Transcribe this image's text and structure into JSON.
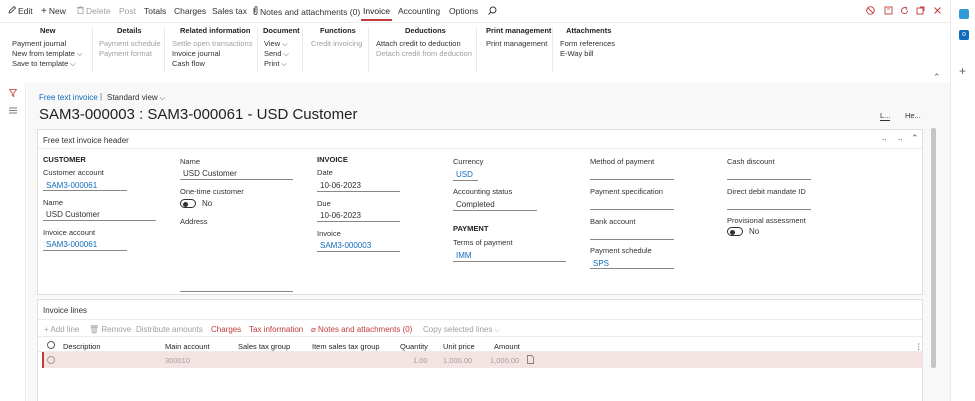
{
  "actionbar": {
    "edit": "Edit",
    "new": "New",
    "delete": "Delete",
    "post": "Post",
    "totals": "Totals",
    "charges": "Charges",
    "sales_tax": "Sales tax",
    "notes": "Notes and attachments (0)",
    "invoice": "Invoice",
    "accounting": "Accounting",
    "options": "Options"
  },
  "ribbon": {
    "new": {
      "title": "New",
      "items": [
        "Payment journal",
        "New from template",
        "Save to template"
      ]
    },
    "details": {
      "title": "Details",
      "items": [
        "Payment schedule",
        "Payment format"
      ]
    },
    "related": {
      "title": "Related information",
      "items": [
        "Settle open transactions",
        "Invoice journal",
        "Cash flow"
      ]
    },
    "document": {
      "title": "Document",
      "items": [
        "View",
        "Send",
        "Print"
      ]
    },
    "functions": {
      "title": "Functions",
      "items": [
        "Credit invoicing"
      ]
    },
    "deductions": {
      "title": "Deductions",
      "items": [
        "Attach credit to deduction",
        "Detach credit from deduction"
      ]
    },
    "print": {
      "title": "Print management",
      "items": [
        "Print management"
      ]
    },
    "attachments": {
      "title": "Attachments",
      "items": [
        "Form references",
        "E-Way bill"
      ]
    }
  },
  "page": {
    "breadcrumb": "Free text invoice",
    "separator": "|",
    "view": "Standard view",
    "title": "SAM3-000003 : SAM3-000061 - USD Customer",
    "right_btn1": "L...",
    "right_btn2": "He..."
  },
  "header": {
    "title": "Free text invoice header",
    "dots": "..",
    "customer": {
      "section": "CUSTOMER",
      "account_label": "Customer account",
      "account_value": "SAM3-000061",
      "name_label": "Name",
      "name_value": "USD Customer",
      "invoice_account_label": "Invoice account",
      "invoice_account_value": "SAM3-000061"
    },
    "col2": {
      "name_label": "Name",
      "name_value": "USD Customer",
      "onetime_label": "One-time customer",
      "onetime_value": "No",
      "address_label": "Address"
    },
    "invoice": {
      "section": "INVOICE",
      "date_label": "Date",
      "date_value": "10-06-2023",
      "due_label": "Due",
      "due_value": "10-06-2023",
      "invoice_label": "Invoice",
      "invoice_value": "SAM3-000003"
    },
    "col4": {
      "currency_label": "Currency",
      "currency_value": "USD",
      "status_label": "Accounting status",
      "status_value": "Completed",
      "payment_section": "PAYMENT",
      "terms_label": "Terms of payment",
      "terms_value": "IMM"
    },
    "col5": {
      "method_label": "Method of payment",
      "spec_label": "Payment specification",
      "bank_label": "Bank account",
      "schedule_label": "Payment schedule",
      "schedule_value": "SPS"
    },
    "col6": {
      "discount_label": "Cash discount",
      "mandate_label": "Direct debit mandate ID",
      "provisional_label": "Provisional assessment",
      "provisional_value": "No"
    }
  },
  "lines": {
    "title": "Invoice lines",
    "toolbar": {
      "add": "Add line",
      "remove": "Remove",
      "distribute": "Distribute amounts",
      "charges": "Charges",
      "tax": "Tax information",
      "notes": "Notes and attachments (0)",
      "copy": "Copy selected lines"
    },
    "columns": [
      "Description",
      "Main account",
      "Sales tax group",
      "Item sales tax group",
      "Quantity",
      "Unit price",
      "Amount"
    ],
    "rows": [
      {
        "description": "",
        "main_account": "300010",
        "sales_tax_group": "",
        "item_sales_tax_group": "",
        "quantity": "1.00",
        "unit_price": "1,000.00",
        "amount": "1,000.00"
      }
    ]
  },
  "colors": {
    "accent": "#c23b3b",
    "link": "#0f6cbd",
    "selected_row": "#f3e3e3"
  }
}
